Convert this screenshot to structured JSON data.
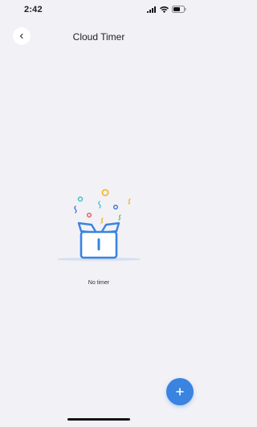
{
  "status_bar": {
    "time": "2:42"
  },
  "nav": {
    "title": "Cloud Timer",
    "back_icon": "chevron-left-icon"
  },
  "empty_state": {
    "message": "No timer",
    "illustration": "gift-box-confetti-illustration"
  },
  "fab": {
    "label": "+",
    "icon": "plus-icon"
  },
  "colors": {
    "background": "#f1f1f6",
    "accent": "#3a83e0",
    "confetti_orange": "#f5b323",
    "confetti_teal": "#43c2c9",
    "confetti_red": "#e5535b",
    "confetti_blue": "#3a6fd8"
  }
}
